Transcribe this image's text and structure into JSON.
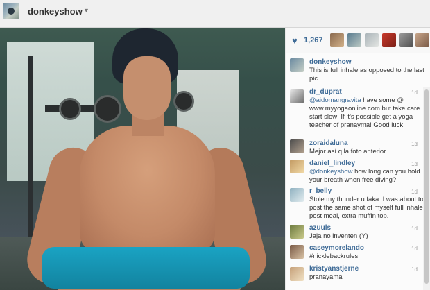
{
  "header": {
    "username": "donkeyshow",
    "caret_icon": "chevron-down-icon"
  },
  "likes": {
    "icon": "heart-icon",
    "count": "1,267"
  },
  "caption": {
    "user": "donkeyshow",
    "text": "This is full inhale as opposed to the last pic."
  },
  "comments": [
    {
      "user": "dr_duprat",
      "mention": "@aidomangravita",
      "text": " have some @ www.myyogaonline.com but take care start slow! If it's possible get a yoga teacher of pranayma! Good luck",
      "time": "1d"
    },
    {
      "user": "zoraidaluna",
      "mention": "",
      "text": "Mejor así q la foto anterior",
      "time": "1d"
    },
    {
      "user": "daniel_lindley",
      "mention": "@donkeyshow",
      "text": " how long can you hold your breath when free diving?",
      "time": "1d"
    },
    {
      "user": "r_belly",
      "mention": "",
      "text": "Stole my thunder u faka. I was about to post the same shot of myself full inhale, post meal, extra muffin top.",
      "time": "1d"
    },
    {
      "user": "azuuls",
      "mention": "",
      "text": "Jaja no inventen (Y)",
      "time": "1d"
    },
    {
      "user": "caseymorelando",
      "mention": "",
      "text": "#nicklebackrules",
      "time": "1d"
    },
    {
      "user": "kristyanstjerne",
      "mention": "",
      "text": "pranayama",
      "time": "1d"
    }
  ]
}
